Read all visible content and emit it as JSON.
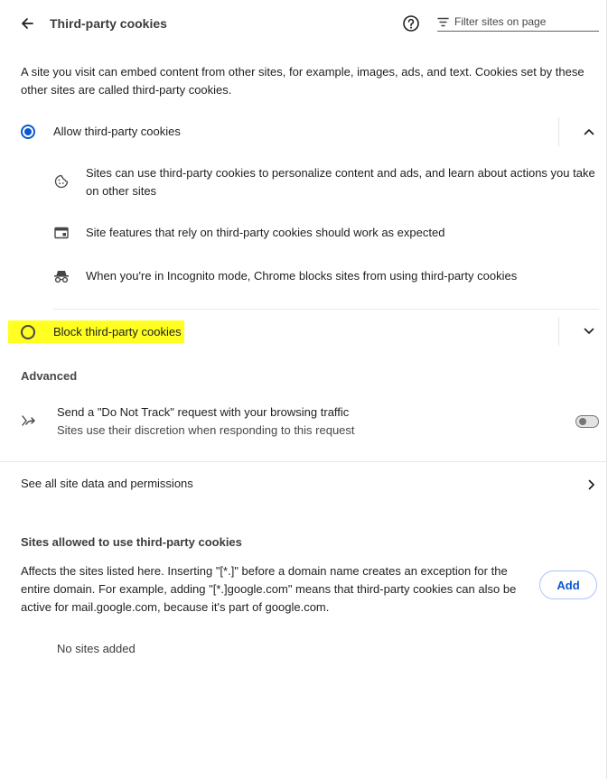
{
  "header": {
    "title": "Third-party cookies",
    "help_icon": "help-circle-icon",
    "filter_placeholder": "Filter sites on page"
  },
  "intro": "A site you visit can embed content from other sites, for example, images, ads, and text. Cookies set by these other sites are called third-party cookies.",
  "options": {
    "allow": {
      "label": "Allow third-party cookies",
      "selected": true,
      "expanded": true,
      "details": [
        {
          "icon": "cookie-icon",
          "text": "Sites can use third-party cookies to personalize content and ads, and learn about actions you take on other sites"
        },
        {
          "icon": "browser-window-icon",
          "text": "Site features that rely on third-party cookies should work as expected"
        },
        {
          "icon": "incognito-icon",
          "text": "When you're in Incognito mode, Chrome blocks sites from using third-party cookies"
        }
      ]
    },
    "block": {
      "label": "Block third-party cookies",
      "selected": false,
      "expanded": false,
      "highlight_color": "#ffff22"
    }
  },
  "advanced": {
    "heading": "Advanced",
    "dnt": {
      "title": "Send a \"Do Not Track\" request with your browsing traffic",
      "subtitle": "Sites use their discretion when responding to this request",
      "enabled": false
    }
  },
  "see_all": {
    "label": "See all site data and permissions"
  },
  "allowed_sites": {
    "heading": "Sites allowed to use third-party cookies",
    "description": "Affects the sites listed here. Inserting \"[*.]\" before a domain name creates an exception for the entire domain. For example, adding \"[*.]google.com\" means that third-party cookies can also be active for mail.google.com, because it's part of google.com.",
    "add_label": "Add",
    "empty_text": "No sites added"
  },
  "colors": {
    "accent": "#0b57d0",
    "text": "#1f1f1f",
    "highlight": "#ffff22"
  }
}
